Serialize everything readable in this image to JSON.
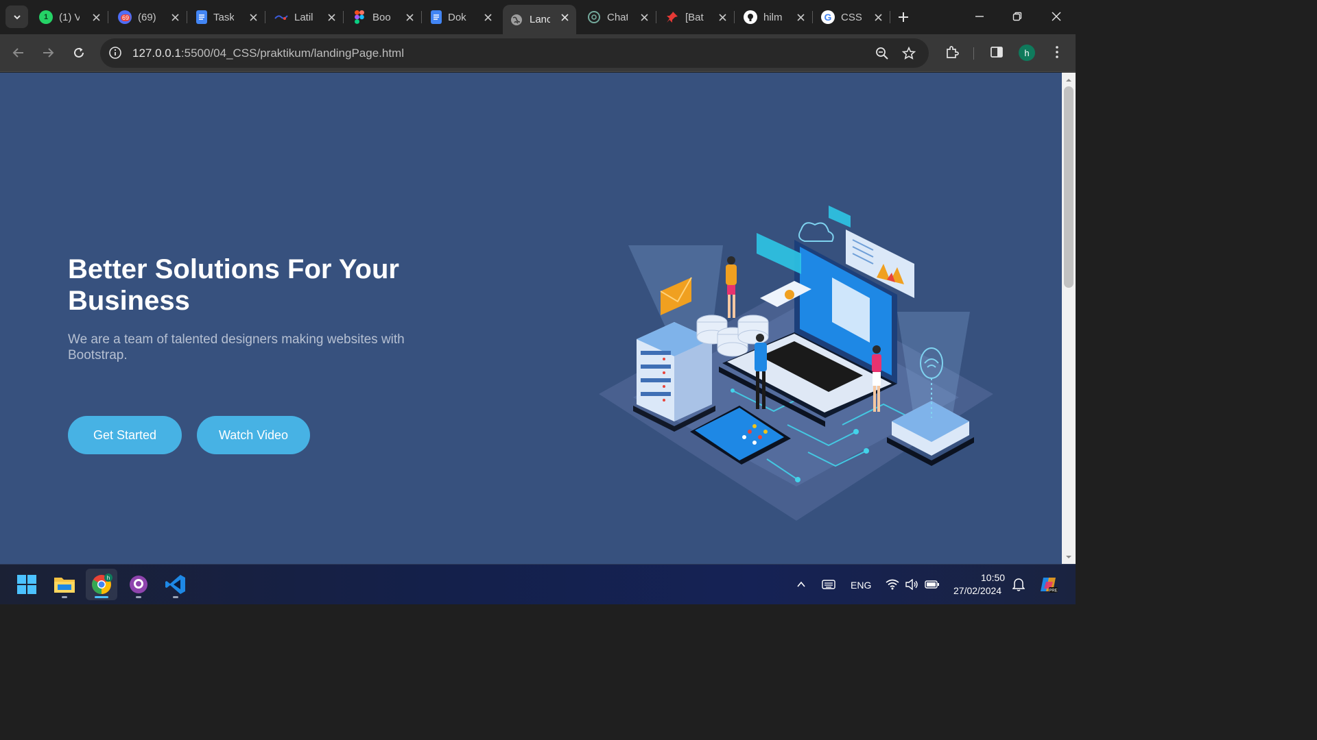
{
  "browser": {
    "tabs": [
      {
        "label": "(1) V",
        "icon": "whatsapp-icon",
        "color": "#25d366"
      },
      {
        "label": "(69)",
        "icon": "notification-app-icon",
        "color": "#e8453c"
      },
      {
        "label": "Task",
        "icon": "google-docs-icon",
        "color": "#4285f4"
      },
      {
        "label": "Latil",
        "icon": "latihan-site-icon",
        "color": "#3b5bdb"
      },
      {
        "label": "Boo",
        "icon": "figma-icon",
        "color": "#f24e1e"
      },
      {
        "label": "Dok",
        "icon": "google-docs-icon",
        "color": "#4285f4"
      },
      {
        "label": "Lanc",
        "icon": "globe-icon",
        "color": "#c7c7c7"
      },
      {
        "label": "Chat",
        "icon": "chatgpt-icon",
        "color": "#74aa9c"
      },
      {
        "label": "[Bat",
        "icon": "pin-icon",
        "color": "#e53935"
      },
      {
        "label": "hilm",
        "icon": "github-icon",
        "color": "#ffffff"
      },
      {
        "label": "CSS",
        "icon": "google-icon",
        "color": "#4285f4"
      }
    ],
    "tab_badge": "69",
    "whatsapp_badge": "1",
    "url_host": "127.0.0.1",
    "url_path": ":5500/04_CSS/praktikum/landingPage.html",
    "profile_initial": "h"
  },
  "page": {
    "title": "Better Solutions For Your Business",
    "subtitle": "We are a team of talented designers making websites with Bootstrap.",
    "primary_button": "Get Started",
    "secondary_button": "Watch Video",
    "colors": {
      "background": "#37517e",
      "accent": "#47b2e4",
      "title": "#ffffff"
    }
  },
  "taskbar": {
    "apps": [
      "windows-start-icon",
      "file-explorer-icon",
      "chrome-icon",
      "github-desktop-icon",
      "vscode-icon"
    ],
    "language": "ENG",
    "time": "10:50",
    "date": "27/02/2024"
  }
}
